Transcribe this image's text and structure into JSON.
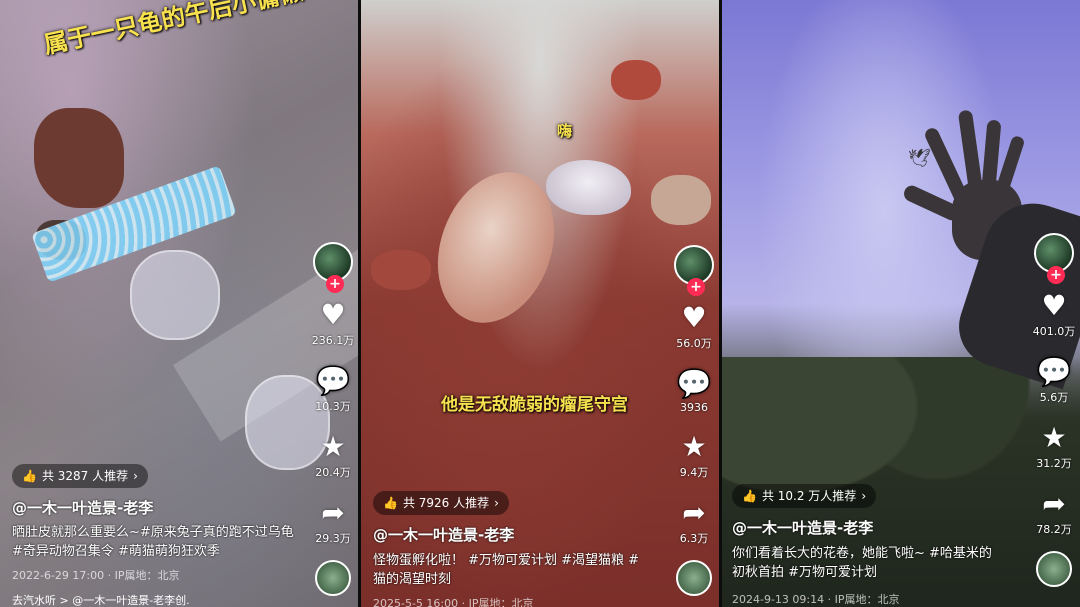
{
  "panels": [
    {
      "caption": "属于一只龟的午后小慵懒",
      "likes": "236.1万",
      "comments": "10.3万",
      "favorites": "20.4万",
      "shares": "29.3万",
      "recommend": "共 3287 人推荐",
      "author": "@一木一叶造景-老李",
      "description": "晒肚皮就那么重要么~#原来兔子真的跑不过乌龟 #奇异动物召集令 #萌猫萌狗狂欢季",
      "meta": "2022-6-29 17:00 · IP属地：北京",
      "music": "去汽水听 > @一木一叶造景-老李创."
    },
    {
      "caption": "他是无敌脆弱的瘤尾守宫",
      "caption_small": "嗨",
      "likes": "56.0万",
      "comments": "3936",
      "favorites": "9.4万",
      "shares": "6.3万",
      "recommend": "共 7926 人推荐",
      "author": "@一木一叶造景-老李",
      "description": "怪物蛋孵化啦！ #万物可爱计划 #渴望猫粮 #猫的渴望时刻",
      "meta": "2025-5-5 16:00 · IP属地：北京"
    },
    {
      "likes": "401.0万",
      "comments": "5.6万",
      "favorites": "31.2万",
      "shares": "78.2万",
      "recommend": "共 10.2 万人推荐",
      "author": "@一木一叶造景-老李",
      "description": "你们看着长大的花卷，她能飞啦~ #哈基米的初秋首拍 #万物可爱计划",
      "meta": "2024-9-13 09:14 · IP属地：北京"
    }
  ],
  "icons": {
    "like": "heart-icon",
    "comment": "comment-bubble-icon",
    "favorite": "star-icon",
    "share": "share-arrow-icon",
    "follow": "plus-icon",
    "recommend": "thumbs-up-icon"
  },
  "colors": {
    "follow": "#fe2c55",
    "caption": "#f7e14f"
  }
}
